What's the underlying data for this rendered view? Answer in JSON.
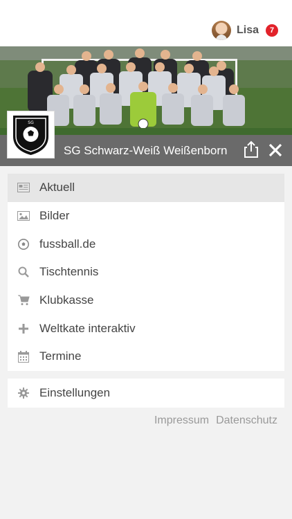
{
  "user": {
    "name": "Lisa",
    "notifications": "7"
  },
  "club": {
    "name": "SG Schwarz-Weiß Weißenborn",
    "crest_text": "SG SCHWARZ-WEISS WEISSENBORN"
  },
  "menu": [
    {
      "label": "Aktuell",
      "icon": "newspaper-icon",
      "active": true
    },
    {
      "label": "Bilder",
      "icon": "image-icon"
    },
    {
      "label": "fussball.de",
      "icon": "soccer-ball-icon"
    },
    {
      "label": "Tischtennis",
      "icon": "search-icon"
    },
    {
      "label": "Klubkasse",
      "icon": "cart-icon"
    },
    {
      "label": "Weltkate interaktiv",
      "icon": "plus-icon"
    },
    {
      "label": "Termine",
      "icon": "calendar-icon"
    }
  ],
  "settings": {
    "label": "Einstellungen",
    "icon": "gear-icon"
  },
  "footer": {
    "impressum": "Impressum",
    "datenschutz": "Datenschutz"
  },
  "colors": {
    "badge": "#e2222a",
    "titlebar": "#6a6a6a",
    "active_item": "#e6e6e6"
  }
}
